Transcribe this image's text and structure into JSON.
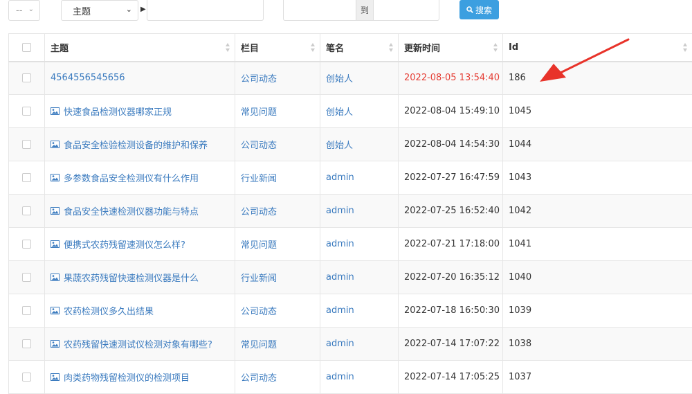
{
  "filters": {
    "operator_placeholder": "-- ",
    "field_selected": "主题",
    "range_separator": "到",
    "search_label": "搜索"
  },
  "table": {
    "headers": {
      "title": "主题",
      "column": "栏目",
      "author": "笔名",
      "updated": "更新时间",
      "id": "Id"
    },
    "rows": [
      {
        "title": "4564556545656",
        "has_image": false,
        "column": "公司动态",
        "author": "创始人",
        "updated": "2022-08-05 13:54:40",
        "updated_highlight": true,
        "id": "186"
      },
      {
        "title": "快速食品检测仪器哪家正规",
        "has_image": true,
        "column": "常见问题",
        "author": "创始人",
        "updated": "2022-08-04 15:49:10",
        "updated_highlight": false,
        "id": "1045"
      },
      {
        "title": "食品安全检验检测设备的维护和保养",
        "has_image": true,
        "column": "公司动态",
        "author": "创始人",
        "updated": "2022-08-04 14:54:30",
        "updated_highlight": false,
        "id": "1044"
      },
      {
        "title": "多参数食品安全检测仪有什么作用",
        "has_image": true,
        "column": "行业新闻",
        "author": "admin",
        "updated": "2022-07-27 16:47:59",
        "updated_highlight": false,
        "id": "1043"
      },
      {
        "title": "食品安全快速检测仪器功能与特点",
        "has_image": true,
        "column": "公司动态",
        "author": "admin",
        "updated": "2022-07-25 16:52:40",
        "updated_highlight": false,
        "id": "1042"
      },
      {
        "title": "便携式农药残留速测仪怎么样?",
        "has_image": true,
        "column": "常见问题",
        "author": "admin",
        "updated": "2022-07-21 17:18:00",
        "updated_highlight": false,
        "id": "1041"
      },
      {
        "title": "果蔬农药残留快速检测仪器是什么",
        "has_image": true,
        "column": "行业新闻",
        "author": "admin",
        "updated": "2022-07-20 16:35:12",
        "updated_highlight": false,
        "id": "1040"
      },
      {
        "title": "农药检测仪多久出结果",
        "has_image": true,
        "column": "公司动态",
        "author": "admin",
        "updated": "2022-07-18 16:50:30",
        "updated_highlight": false,
        "id": "1039"
      },
      {
        "title": "农药残留快速测试仪检测对象有哪些?",
        "has_image": true,
        "column": "常见问题",
        "author": "admin",
        "updated": "2022-07-14 17:07:22",
        "updated_highlight": false,
        "id": "1038"
      },
      {
        "title": "肉类药物残留检测仪的检测项目",
        "has_image": true,
        "column": "公司动态",
        "author": "admin",
        "updated": "2022-07-14 17:05:25",
        "updated_highlight": false,
        "id": "1037"
      }
    ]
  },
  "colors": {
    "link": "#3b7bbf",
    "highlight_time": "#e53e35",
    "search_button": "#3c9fe0",
    "annotation_arrow": "#e8332a"
  },
  "icons": {
    "row_image": "image-icon",
    "sort": "sort-icon",
    "search": "search-icon"
  }
}
